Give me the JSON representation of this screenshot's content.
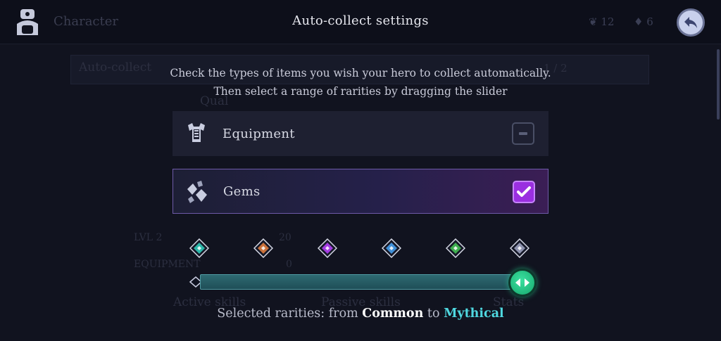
{
  "topbar": {
    "background_title": "Character",
    "title": "Auto-collect settings",
    "currency_a": "12",
    "currency_b": "6"
  },
  "background": {
    "tab_label": "Auto-collect",
    "page_counter": "1 / 2",
    "quality_label": "Qual",
    "level_label": "LVL 2",
    "level_max": "20",
    "equipment_label": "EQUIPMENT",
    "equipment_count": "0",
    "tabs": [
      "Active skills",
      "Passive skills",
      "Stats"
    ]
  },
  "dialog": {
    "description_line1": "Check the types of items you wish your hero to collect automatically.",
    "description_line2": "Then select a range of rarities by dragging the slider",
    "categories": [
      {
        "label": "Equipment",
        "icon": "armor-icon",
        "state": "partial"
      },
      {
        "label": "Gems",
        "icon": "gems-icon",
        "state": "checked"
      }
    ],
    "rarity_colors": [
      "#2bb5a8",
      "#c9713a",
      "#a23be0",
      "#3f8fd8",
      "#3fae4f",
      "#8c91ad"
    ],
    "slider": {
      "min_index": 0,
      "max_index": 5
    },
    "selected_prefix": "Selected rarities: from",
    "selected_from": "Common",
    "selected_mid": "to",
    "selected_to": "Mythical"
  },
  "colors": {
    "accent_teal": "#4fd8e0",
    "check_purple": "#9a2fe0",
    "handle_green": "#22c07f"
  }
}
